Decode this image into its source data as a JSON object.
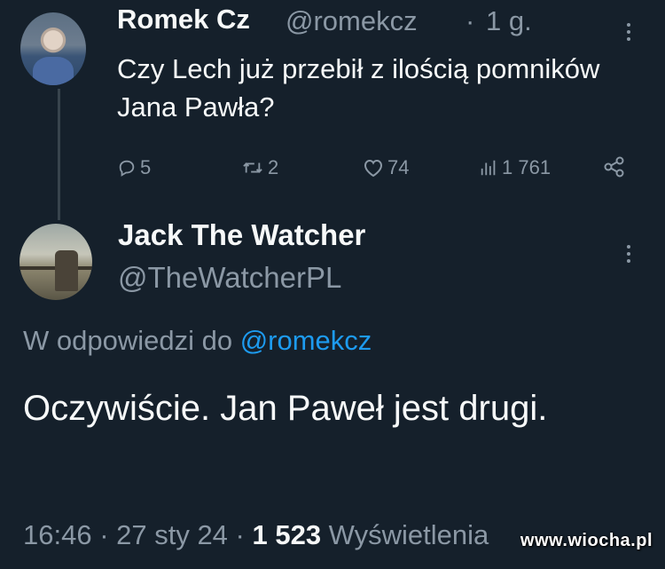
{
  "tweet": {
    "author_name": "Romek Cz",
    "author_handle": "@romekcz",
    "separator": "·",
    "time": "1 g.",
    "text": "Czy Lech już przebił z ilością pomników Jana Pawła?",
    "actions": {
      "replies": "5",
      "retweets": "2",
      "likes": "74",
      "views": "1 761"
    }
  },
  "reply": {
    "author_name": "Jack The Watcher",
    "author_handle": "@TheWatcherPL",
    "reply_prefix": "W odpowiedzi do",
    "reply_mention": "@romekcz",
    "text": "Oczywiście. Jan Paweł jest drugi.",
    "timestamp": "16:46 · 27 sty 24 · ",
    "views_count": "1 523",
    "views_label": " Wyświetlenia"
  },
  "watermark": "www.wiocha.pl",
  "colors": {
    "background": "#15202b",
    "text_primary": "#f7f9f9",
    "text_secondary": "#8b98a5",
    "accent": "#1d9bf0"
  },
  "icons": [
    "reply-icon",
    "retweet-icon",
    "like-icon",
    "views-icon",
    "share-icon",
    "more-icon"
  ]
}
